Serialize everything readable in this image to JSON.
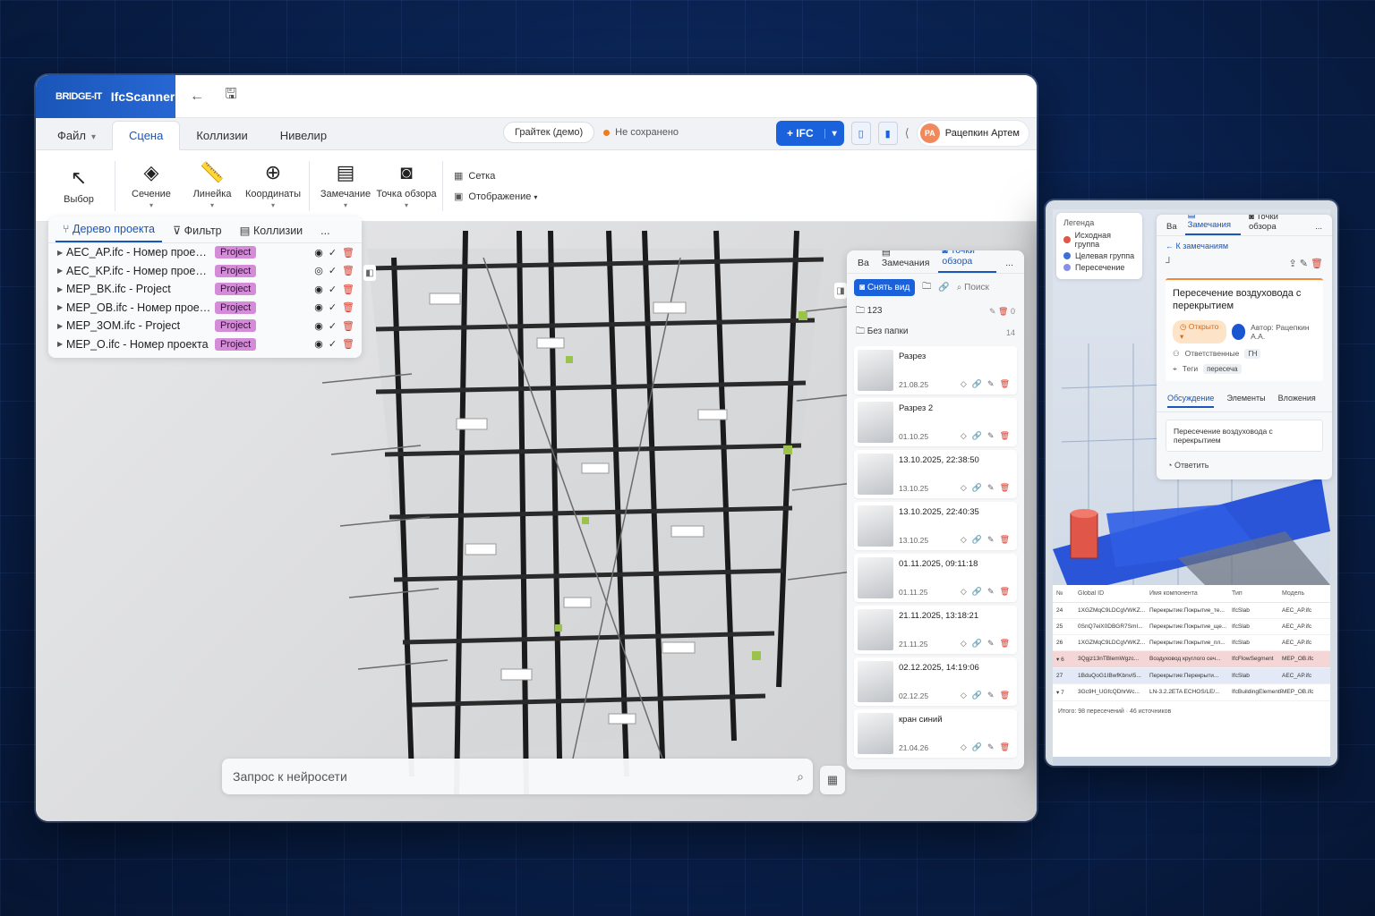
{
  "brand": {
    "logo": "BRIDGE-IT",
    "name": "IfcScanner"
  },
  "menu": {
    "tabs": [
      {
        "label": "Файл"
      },
      {
        "label": "Сцена"
      },
      {
        "label": "Коллизии"
      },
      {
        "label": "Нивелир"
      }
    ]
  },
  "project": {
    "name": "Грайтек (демо)",
    "status": "Не сохранено"
  },
  "header": {
    "ifc_button": "+ IFC",
    "user_initials": "РА",
    "user_name": "Рацепкин Артем"
  },
  "toolbar": {
    "items": [
      {
        "label": "Выбор"
      },
      {
        "label": "Сечение"
      },
      {
        "label": "Линейка"
      },
      {
        "label": "Координаты"
      },
      {
        "label": "Замечание"
      },
      {
        "label": "Точка обзора"
      }
    ],
    "grid_label": "Сетка",
    "display_label": "Отображение"
  },
  "tree": {
    "tabs": [
      {
        "label": "Дерево проекта"
      },
      {
        "label": "Фильтр"
      },
      {
        "label": "Коллизии"
      }
    ],
    "more": "...",
    "items": [
      {
        "name": "AEC_AP.ifc - Номер проекта",
        "badge": "Project"
      },
      {
        "name": "AEC_KP.ifc - Номер проекта",
        "badge": "Project"
      },
      {
        "name": "MEP_BK.ifc - Project",
        "badge": "Project"
      },
      {
        "name": "MEP_OB.ifc - Номер проекта",
        "badge": "Project"
      },
      {
        "name": "MEP_3OM.ifc - Project",
        "badge": "Project"
      },
      {
        "name": "MEP_O.ifc - Номер проекта",
        "badge": "Project"
      }
    ]
  },
  "viewpoints": {
    "tabs": [
      {
        "label": "Ва"
      },
      {
        "label": "Замечания"
      },
      {
        "label": "Точки обзора"
      }
    ],
    "more": "...",
    "snap_button": "Снять вид",
    "search_placeholder": "Поиск",
    "folders": [
      {
        "name": "123",
        "count": "0"
      },
      {
        "name": "Без папки",
        "count": "14"
      }
    ],
    "items": [
      {
        "title": "Разрез",
        "date": "21.08.25"
      },
      {
        "title": "Разрез 2",
        "date": "01.10.25"
      },
      {
        "title": "13.10.2025, 22:38:50",
        "date": "13.10.25"
      },
      {
        "title": "13.10.2025, 22:40:35",
        "date": "13.10.25"
      },
      {
        "title": "01.11.2025, 09:11:18",
        "date": "01.11.25"
      },
      {
        "title": "21.11.2025, 13:18:21",
        "date": "21.11.25"
      },
      {
        "title": "02.12.2025, 14:19:06",
        "date": "02.12.25"
      },
      {
        "title": "кран синий",
        "date": "21.04.26"
      }
    ]
  },
  "query": {
    "placeholder": "Запрос к нейросети"
  },
  "legend": {
    "title": "Легенда",
    "items": [
      {
        "label": "Исходная группа",
        "color": "#e0574a"
      },
      {
        "label": "Целевая группа",
        "color": "#3c6fd8"
      },
      {
        "label": "Пересечение",
        "color": "#8a8fe0"
      }
    ]
  },
  "issue": {
    "tabs": [
      {
        "label": "Ва"
      },
      {
        "label": "Замечания"
      },
      {
        "label": "Точки обзора"
      }
    ],
    "more": "...",
    "back": "← К замечаниям",
    "title": "Пересечение воздуховода с перекрытием",
    "status": "Открыто",
    "author": "Автор: Рацепкин А.А.",
    "responsible_label": "Ответственные",
    "responsible_value": "ГН",
    "tags_label": "Теги",
    "tags_value": "пересеча",
    "subtabs": [
      {
        "label": "Обсуждение"
      },
      {
        "label": "Элементы"
      },
      {
        "label": "Вложения"
      }
    ],
    "comment": "Пересечение воздуховода с перекрытием",
    "reply": "Ответить"
  },
  "collisions": {
    "headers": [
      "№",
      "Global ID",
      "Имя компонента",
      "Тип",
      "Модель"
    ],
    "rows": [
      {
        "n": "24",
        "gid": "1XGZMqC9LDCgVWKZ...",
        "name": "Перекрытие:Покрытие_те...",
        "type": "IfcSlab",
        "model": "AEC_AP.ifc",
        "style": ""
      },
      {
        "n": "25",
        "gid": "0SnQ7eiX0DBGR7SmI...",
        "name": "Перекрытие:Покрытие_ще...",
        "type": "IfcSlab",
        "model": "AEC_AP.ifc",
        "style": ""
      },
      {
        "n": "26",
        "gid": "1XGZMqC9LDCgVWKZ...",
        "name": "Перекрытие:Покрытие_пл...",
        "type": "IfcSlab",
        "model": "AEC_AP.ifc",
        "style": ""
      },
      {
        "n": "▾ 6",
        "gid": "3Qgjz13nTBlemWgzc...",
        "name": "Воздуховод круглого сеч...",
        "type": "IfcFlowSegment",
        "model": "MEP_OB.ifc",
        "style": "red"
      },
      {
        "n": "27",
        "gid": "1BduQoG1IBwfKbnvI5...",
        "name": "Перекрытие:Перекрыти...",
        "type": "IfcSlab",
        "model": "AEC_AP.ifc",
        "style": "blue"
      },
      {
        "n": "▾ 7",
        "gid": "3Gc9H_UGfcQDhrWc...",
        "name": "LN-3.2.2ETA ECHOS/LE/...",
        "type": "IfcBuildingElementProxy",
        "model": "MEP_OB.ifc",
        "style": ""
      }
    ],
    "footer": "Итого: 98 пересечений · 46 источников"
  }
}
